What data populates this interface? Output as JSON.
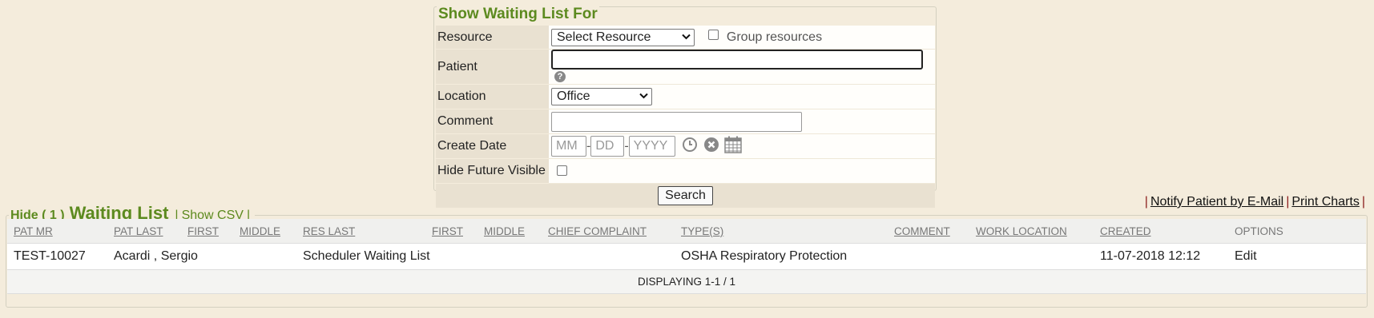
{
  "search_form": {
    "legend": "Show Waiting List For",
    "resource_label": "Resource",
    "resource_selected": "Select Resource",
    "group_resources_label": "Group resources",
    "patient_label": "Patient",
    "patient_value": "",
    "help_icon_glyph": "?",
    "location_label": "Location",
    "location_selected": "Office",
    "comment_label": "Comment",
    "comment_value": "",
    "create_date_label": "Create Date",
    "date_placeholders": {
      "month": "MM",
      "day": "DD",
      "year": "YYYY"
    },
    "date_separator": "-",
    "hide_future_label": "Hide Future Visible",
    "search_button": "Search"
  },
  "top_links": {
    "notify": "Notify Patient by E-Mail",
    "print": "Print Charts",
    "separator": "|"
  },
  "waiting_list": {
    "hide_label": "Hide ( 1 )",
    "title": "Waiting List",
    "show_csv": "Show CSV",
    "separator": "|",
    "columns": [
      "PAT MR",
      "PAT LAST",
      "FIRST",
      "MIDDLE",
      "RES LAST",
      "FIRST",
      "MIDDLE",
      "CHIEF COMPLAINT",
      "TYPE(S)",
      "COMMENT",
      "WORK LOCATION",
      "CREATED",
      "OPTIONS"
    ],
    "rows": [
      {
        "pat_mr": "TEST-10027",
        "pat_name": "Acardi , Sergio",
        "res_last": "Scheduler Waiting List",
        "types": "OSHA Respiratory Protection",
        "created": "11-07-2018 12:12",
        "option": "Edit"
      }
    ],
    "footer": "DISPLAYING 1-1 / 1"
  },
  "colors": {
    "background": "#f4ecdc",
    "accent_green": "#5c8a1f",
    "link_pipe": "#8a1a1a"
  },
  "icons": [
    "chevron-down-icon",
    "help-icon",
    "clock-icon",
    "clear-icon",
    "calendar-icon"
  ]
}
